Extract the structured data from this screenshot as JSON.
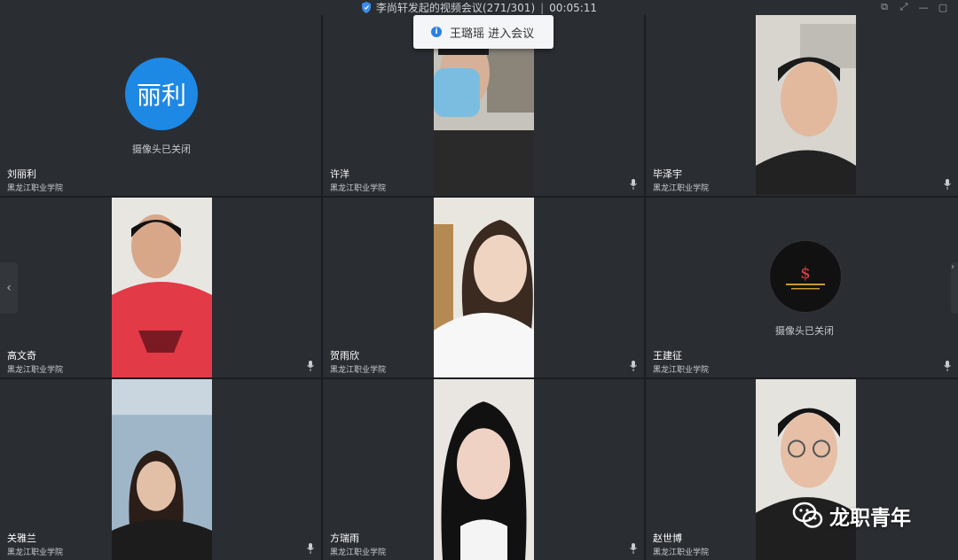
{
  "window": {
    "title": "李尚轩发起的视频会议(271/301)",
    "timer": "00:05:11",
    "controls": [
      "open-external",
      "expand",
      "minimize",
      "maximize"
    ]
  },
  "notification": {
    "text": "王璐瑶 进入会议",
    "icon": "info-icon"
  },
  "participants": [
    {
      "name": "刘丽利",
      "org": "黑龙江职业学院",
      "camera": "off",
      "avatar_text": "丽利",
      "avatar_color": "#1e88e5",
      "status": "摄像头已关闭"
    },
    {
      "name": "许洋",
      "org": "黑龙江职业学院",
      "camera": "on",
      "muted_icon": "mic-icon"
    },
    {
      "name": "毕泽宇",
      "org": "黑龙江职业学院",
      "camera": "on",
      "muted_icon": "mic-icon"
    },
    {
      "name": "高文奇",
      "org": "黑龙江职业学院",
      "camera": "on",
      "muted_icon": "mic-icon"
    },
    {
      "name": "贺雨欣",
      "org": "黑龙江职业学院",
      "camera": "on",
      "muted_icon": "mic-icon"
    },
    {
      "name": "王建征",
      "org": "黑龙江职业学院",
      "camera": "off",
      "avatar_color": "#111111",
      "status": "摄像头已关闭",
      "muted_icon": "mic-icon"
    },
    {
      "name": "关雅兰",
      "org": "黑龙江职业学院",
      "camera": "on",
      "muted_icon": "mic-icon"
    },
    {
      "name": "方瑞雨",
      "org": "黑龙江职业学院",
      "camera": "on",
      "muted_icon": "mic-icon"
    },
    {
      "name": "赵世博",
      "org": "黑龙江职业学院",
      "camera": "on",
      "muted_icon": "mic-icon"
    }
  ],
  "navigation": {
    "prev": "‹",
    "next": "›"
  },
  "watermark": {
    "text": "龙职青年",
    "icon": "wechat-icon"
  }
}
